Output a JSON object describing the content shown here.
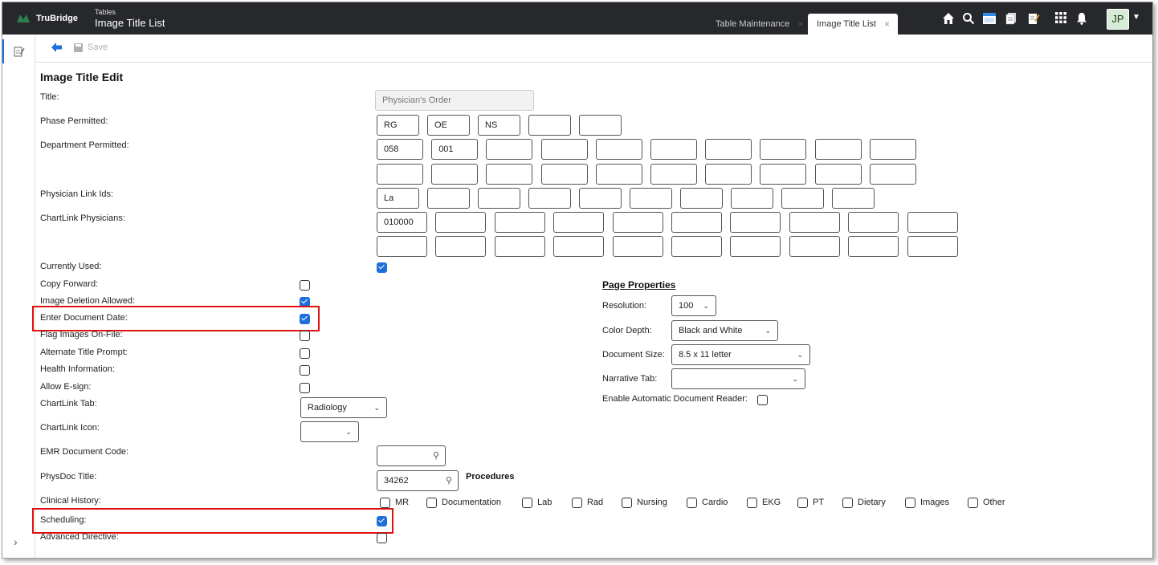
{
  "app": {
    "logo": "TruBridge",
    "section": "Tables",
    "title": "Image Title List"
  },
  "tabs": [
    {
      "label": "Table Maintenance",
      "close": "×"
    },
    {
      "label": "Image Title List",
      "close": "×"
    }
  ],
  "user": {
    "initials": "JP"
  },
  "toolbar": {
    "save_label": "Save"
  },
  "form": {
    "heading": "Image Title Edit",
    "title_label": "Title:",
    "title_placeholder": "Physician's Order",
    "phase_label": "Phase Permitted:",
    "phase_values": [
      "RG",
      "OE",
      "NS",
      "",
      ""
    ],
    "dept_label": "Department Permitted:",
    "dept_row1": [
      "058",
      "001",
      "",
      "",
      "",
      "",
      "",
      "",
      "",
      ""
    ],
    "dept_row2": [
      "",
      "",
      "",
      "",
      "",
      "",
      "",
      "",
      "",
      ""
    ],
    "physlink_label": "Physician Link Ids:",
    "physlink_values": [
      "La",
      "",
      "",
      "",
      "",
      "",
      "",
      "",
      "",
      ""
    ],
    "chartlink_label": "ChartLink Physicians:",
    "chartlink_row1": [
      "010000",
      "",
      "",
      "",
      "",
      "",
      "",
      "",
      "",
      ""
    ],
    "chartlink_row2": [
      "",
      "",
      "",
      "",
      "",
      "",
      "",
      "",
      "",
      ""
    ],
    "currently_used_label": "Currently Used:",
    "copy_forward_label": "Copy Forward:",
    "image_deletion_label": "Image Deletion Allowed:",
    "enter_doc_date_label": "Enter Document Date:",
    "flag_images_label": "Flag Images On-File:",
    "alt_title_label": "Alternate Title Prompt:",
    "health_info_label": "Health Information:",
    "allow_esign_label": "Allow E-sign:",
    "chartlink_tab_label": "ChartLink Tab:",
    "chartlink_tab_value": "Radiology",
    "chartlink_icon_label": "ChartLink Icon:",
    "chartlink_icon_value": "",
    "emr_code_label": "EMR Document Code:",
    "emr_code_value": "",
    "physdoc_label": "PhysDoc Title:",
    "physdoc_value": "34262",
    "clinical_history_label": "Clinical History:",
    "scheduling_label": "Scheduling:",
    "advanced_directive_label": "Advanced Directive:"
  },
  "checks": {
    "currently_used": true,
    "copy_forward": false,
    "image_deletion": true,
    "enter_doc_date": true,
    "flag_images": false,
    "alt_title": false,
    "health_info": false,
    "allow_esign": false,
    "scheduling": true,
    "advanced_directive": false
  },
  "procedures": {
    "title": "Procedures",
    "items": [
      "MR",
      "Documentation",
      "Lab",
      "Rad",
      "Nursing",
      "Cardio",
      "EKG",
      "PT",
      "Dietary",
      "Images",
      "Other"
    ]
  },
  "page_properties": {
    "title": "Page Properties",
    "resolution_label": "Resolution:",
    "resolution_value": "100",
    "color_depth_label": "Color Depth:",
    "color_depth_value": "Black and White",
    "doc_size_label": "Document Size:",
    "doc_size_value": "8.5 x 11 letter",
    "narrative_label": "Narrative Tab:",
    "narrative_value": "",
    "auto_reader_label": "Enable Automatic Document Reader:",
    "auto_reader_checked": false
  },
  "colors": {
    "accent": "#1e6fd9",
    "highlight": "#e01010",
    "topbar": "#26282b"
  }
}
